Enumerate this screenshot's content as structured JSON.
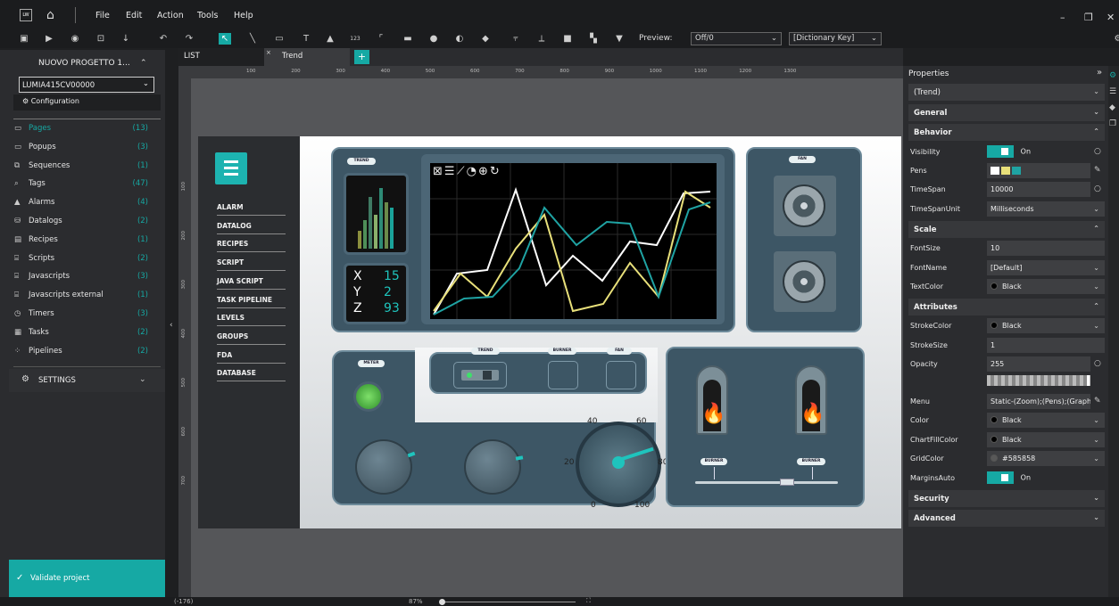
{
  "menu": {
    "file": "File",
    "edit": "Edit",
    "action": "Action",
    "tools": "Tools",
    "help": "Help"
  },
  "toolbar": {
    "preview_label": "Preview:",
    "preview_value": "Off/0",
    "dictionary_value": "[Dictionary Key]"
  },
  "project": {
    "title": "NUOVO PROGETTO 1...",
    "device": "LUMIA415CV00000",
    "configuration": "Configuration"
  },
  "nav": [
    {
      "label": "Pages",
      "count": "(13)"
    },
    {
      "label": "Popups",
      "count": "(3)"
    },
    {
      "label": "Sequences",
      "count": "(1)"
    },
    {
      "label": "Tags",
      "count": "(47)"
    },
    {
      "label": "Alarms",
      "count": "(4)"
    },
    {
      "label": "Datalogs",
      "count": "(2)"
    },
    {
      "label": "Recipes",
      "count": "(1)"
    },
    {
      "label": "Scripts",
      "count": "(2)"
    },
    {
      "label": "Javascripts",
      "count": "(3)"
    },
    {
      "label": "Javascripts external",
      "count": "(1)"
    },
    {
      "label": "Timers",
      "count": "(3)"
    },
    {
      "label": "Tasks",
      "count": "(2)"
    },
    {
      "label": "Pipelines",
      "count": "(2)"
    }
  ],
  "settings_label": "SETTINGS",
  "validate_label": "Validate project",
  "tabs": {
    "list": "LIST",
    "trend": "Trend",
    "add": "+"
  },
  "ruler_top": [
    "100",
    "200",
    "300",
    "400",
    "500",
    "600",
    "700",
    "800",
    "900",
    "1000",
    "1100",
    "1200",
    "1300"
  ],
  "ruler_left": [
    "100",
    "200",
    "300",
    "400",
    "500",
    "600",
    "700"
  ],
  "hmi": {
    "menu": [
      "ALARM",
      "DATALOG",
      "RECIPES",
      "SCRIPT",
      "JAVA SCRIPT",
      "TASK PIPELINE",
      "LEVELS",
      "GROUPS",
      "FDA",
      "DATABASE"
    ],
    "trend_pill": "TREND",
    "fan_pill": "FAN",
    "meter_pill": "METER",
    "burner_pill": "BURNER",
    "xyz": [
      {
        "k": "X",
        "v": "15"
      },
      {
        "k": "Y",
        "v": "2"
      },
      {
        "k": "Z",
        "v": "93"
      }
    ],
    "gauge": [
      "40",
      "60",
      "20",
      "80",
      "0",
      "100"
    ]
  },
  "properties": {
    "header": "Properties",
    "selector": "(Trend)",
    "sections": {
      "general": "General",
      "behavior": "Behavior",
      "scale": "Scale",
      "attributes": "Attributes",
      "security": "Security",
      "advanced": "Advanced"
    },
    "visibility": {
      "label": "Visibility",
      "value": "On"
    },
    "pens": {
      "label": "Pens"
    },
    "timespan": {
      "label": "TimeSpan",
      "value": "10000"
    },
    "timespanunit": {
      "label": "TimeSpanUnit",
      "value": "Milliseconds"
    },
    "fontsize": {
      "label": "FontSize",
      "value": "10"
    },
    "fontname": {
      "label": "FontName",
      "value": "[Default]"
    },
    "textcolor": {
      "label": "TextColor",
      "value": "Black"
    },
    "strokecolor": {
      "label": "StrokeColor",
      "value": "Black"
    },
    "strokesize": {
      "label": "StrokeSize",
      "value": "1"
    },
    "opacity": {
      "label": "Opacity",
      "value": "255"
    },
    "menu": {
      "label": "Menu",
      "value": "Static-(Zoom);(Pens);(GraphM"
    },
    "color": {
      "label": "Color",
      "value": "Black"
    },
    "chartfillcolor": {
      "label": "ChartFillColor",
      "value": "Black"
    },
    "gridcolor": {
      "label": "GridColor",
      "value": "#585858"
    },
    "marginsauto": {
      "label": "MarginsAuto",
      "value": "On"
    }
  },
  "status": {
    "coord": "(-176)",
    "zoom": "87%"
  },
  "colors": {
    "accent": "#16a9a4",
    "panel": "#3d5665",
    "trend_white": "#ffffff",
    "trend_yellow": "#e8e07a",
    "trend_teal": "#1fa3a3"
  }
}
